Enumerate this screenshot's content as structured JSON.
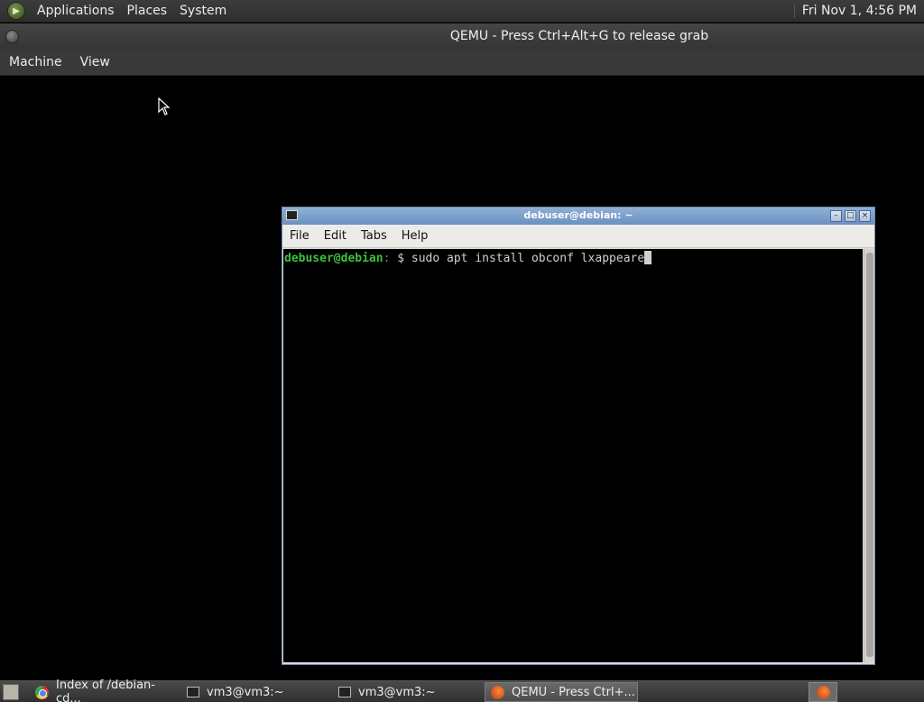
{
  "host_panel": {
    "menus": [
      "Applications",
      "Places",
      "System"
    ],
    "clock": "Fri Nov 1,  4:56 PM"
  },
  "qemu": {
    "title": "QEMU - Press Ctrl+Alt+G to release grab",
    "menus": [
      "Machine",
      "View"
    ]
  },
  "terminal": {
    "title": "debuser@debian: ~",
    "menus": [
      "File",
      "Edit",
      "Tabs",
      "Help"
    ],
    "prompt_user": "debuser@debian",
    "prompt_sep": ":",
    "prompt_rest": " $ ",
    "command": "sudo apt install obconf lxappeare"
  },
  "taskbar": {
    "items": [
      {
        "label": "Index of /debian-cd...",
        "icon": "chrome-icon"
      },
      {
        "label": "vm3@vm3:~",
        "icon": "terminal-icon"
      },
      {
        "label": "vm3@vm3:~",
        "icon": "terminal-icon"
      },
      {
        "label": "QEMU - Press Ctrl+...",
        "icon": "qemu-icon"
      }
    ]
  }
}
